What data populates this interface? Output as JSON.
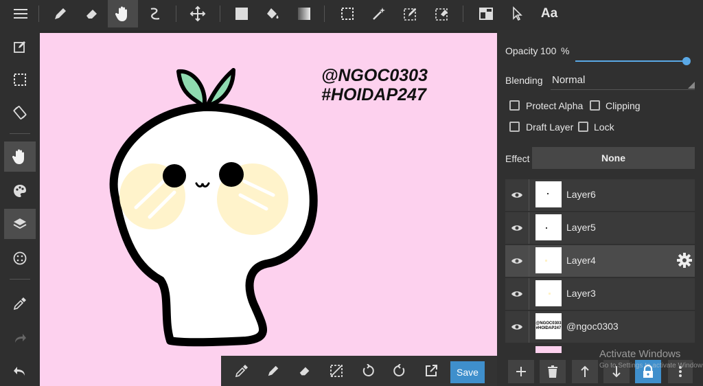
{
  "toolbar": {
    "icons": [
      "menu-icon",
      "pen-icon",
      "eraser-icon",
      "hand-icon",
      "curve-icon",
      "move-icon",
      "fill-rect-icon",
      "bucket-icon",
      "gradient-icon",
      "select-rect-icon",
      "magic-wand-icon",
      "select-pen-icon",
      "select-eraser-icon",
      "layout-icon",
      "cursor-icon",
      "text-icon"
    ],
    "text_tool_label": "Aa"
  },
  "leftbar": {
    "icons": [
      "edit-icon",
      "selection-icon",
      "rotate-icon",
      "hand-icon",
      "palette-icon",
      "layers-icon",
      "material-icon",
      "eyedropper-icon",
      "redo-icon",
      "undo-icon"
    ]
  },
  "canvas": {
    "background": "#fdd1ee",
    "text_line1": "@NGOC0303",
    "text_line2": "#HOIDAP247"
  },
  "panel": {
    "opacity_label": "Opacity",
    "opacity_value": "100",
    "opacity_unit": "%",
    "opacity_fraction": 1.0,
    "blending_label": "Blending",
    "blending_value": "Normal",
    "protect_alpha_label": "Protect Alpha",
    "clipping_label": "Clipping",
    "draft_layer_label": "Draft Layer",
    "lock_label": "Lock",
    "effect_label": "Effect",
    "effect_value": "None",
    "layers": [
      {
        "name": "Layer6",
        "selected": false
      },
      {
        "name": "Layer5",
        "selected": false
      },
      {
        "name": "Layer4",
        "selected": true
      },
      {
        "name": "Layer3",
        "selected": false
      },
      {
        "name": "@ngoc0303",
        "selected": false
      }
    ],
    "thumb_text_1": "@NGOC0303",
    "thumb_text_2": "#HOIDAP247"
  },
  "bottombar": {
    "save_label": "Save",
    "icons": [
      "eyedropper-icon",
      "pen-icon",
      "eraser-icon",
      "deselect-icon",
      "rotate-left-icon",
      "rotate-right-icon",
      "export-icon"
    ]
  },
  "layer_actions": {
    "icons": [
      "add-icon",
      "trash-icon",
      "move-up-icon",
      "move-down-icon",
      "lock-icon",
      "more-icon"
    ]
  },
  "watermark": {
    "title": "Activate Windows",
    "subtitle": "Go to Settings to activate Windows."
  },
  "colors": {
    "accent": "#3f8fcc",
    "slider": "#5aa9e6",
    "panel_bg": "#303030",
    "toolbar_bg": "#2f2f2f"
  }
}
